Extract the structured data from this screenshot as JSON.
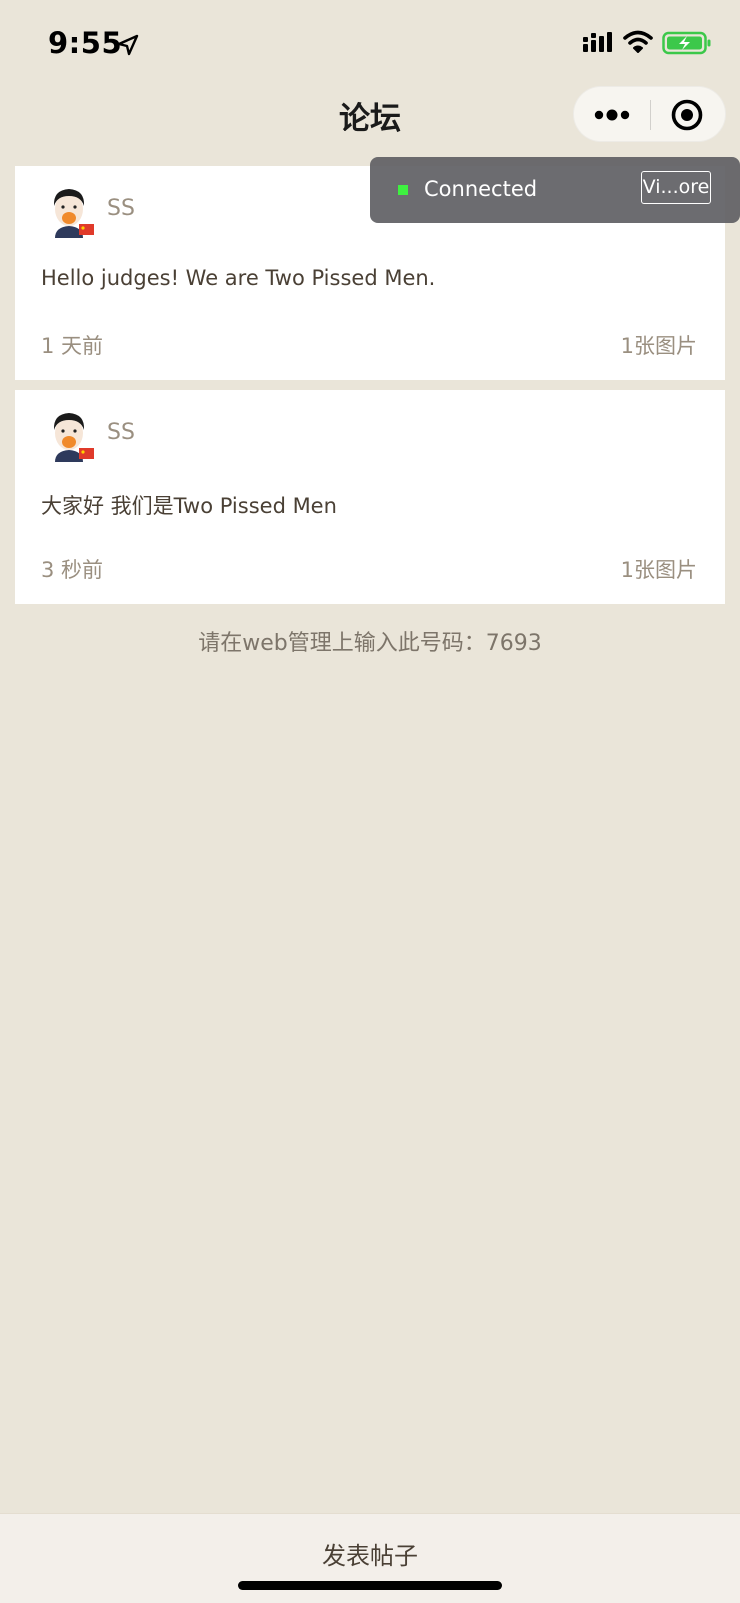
{
  "status_bar": {
    "time": "9:55"
  },
  "nav": {
    "title": "论坛"
  },
  "toast": {
    "status": "Connected",
    "button_label": "Vi...ore",
    "status_color": "#3ef040"
  },
  "posts": [
    {
      "author": "SS",
      "text": "Hello judges! We are Two Pissed Men.",
      "time": "1 天前",
      "images": "1张图片"
    },
    {
      "author": "SS",
      "text": "大家好 我们是Two Pissed Men",
      "time": "3 秒前",
      "images": "1张图片"
    }
  ],
  "code_prompt": "请在web管理上输入此号码：7693",
  "bottom_bar": {
    "button_label": "发表帖子"
  },
  "colors": {
    "background": "#EAE5D9",
    "card": "#ffffff",
    "muted_text": "#9a8f80",
    "body_text": "#4a4035"
  }
}
